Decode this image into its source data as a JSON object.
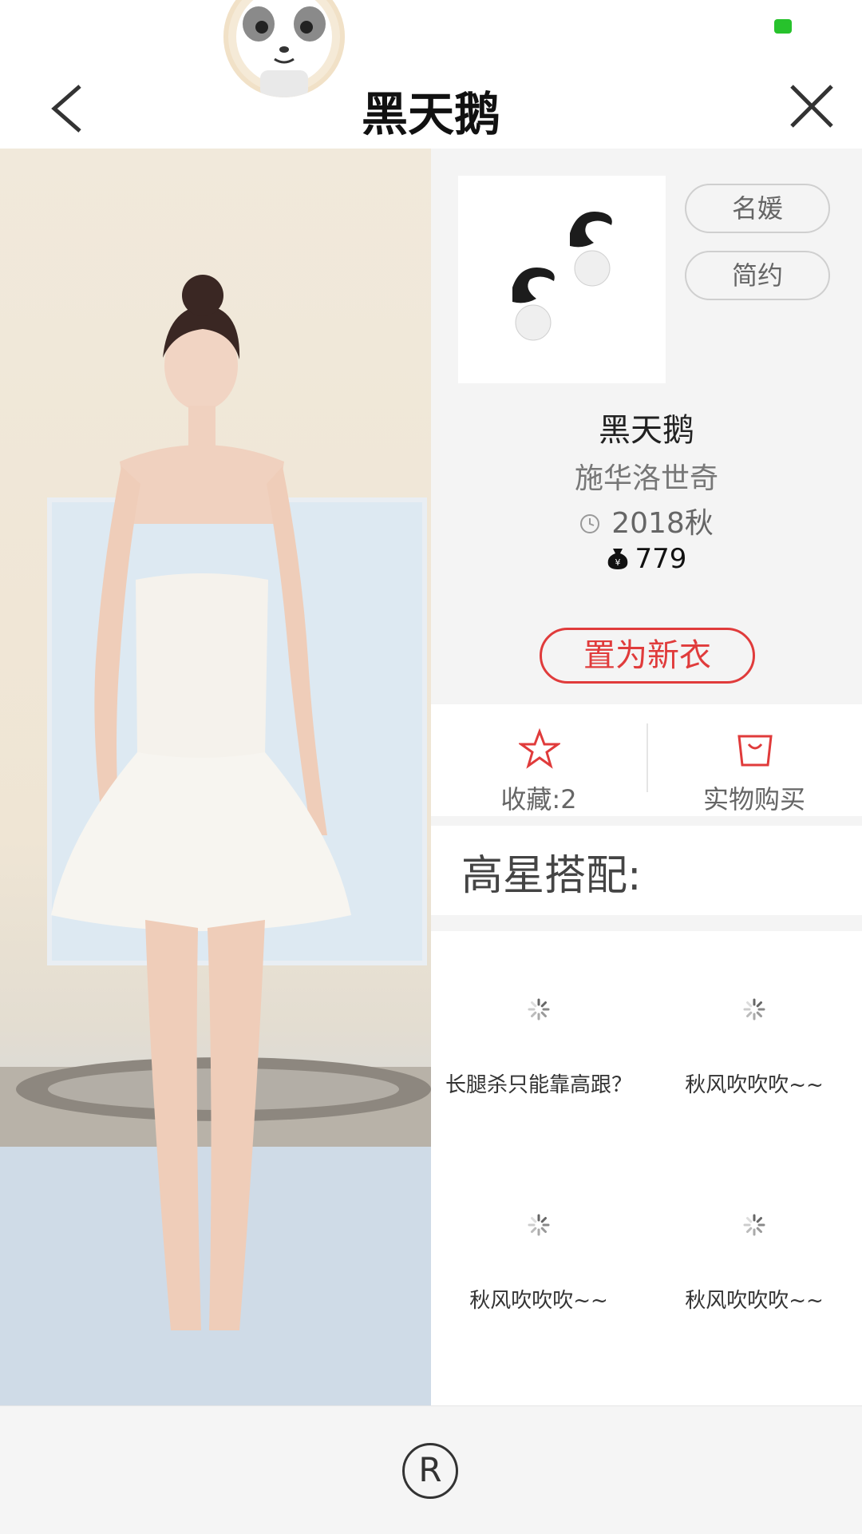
{
  "header": {
    "title": "黑天鹅"
  },
  "product": {
    "tags": [
      "名媛",
      "简约"
    ],
    "name": "黑天鹅",
    "brand": "施华洛世奇",
    "season": "2018秋",
    "price": "779",
    "set_new_label": "置为新衣"
  },
  "actions": {
    "favorite_label": "收藏:2",
    "buy_label": "实物购买"
  },
  "section": {
    "title": "高星搭配:"
  },
  "matches": [
    {
      "caption": "长腿杀只能靠高跟？"
    },
    {
      "caption": "秋风吹吹吹~~"
    },
    {
      "caption": "秋风吹吹吹~~"
    },
    {
      "caption": "秋风吹吹吹~~"
    }
  ],
  "footer": {
    "mark": "R"
  },
  "colors": {
    "accent": "#e03b3b",
    "status_green": "#27c22c"
  }
}
